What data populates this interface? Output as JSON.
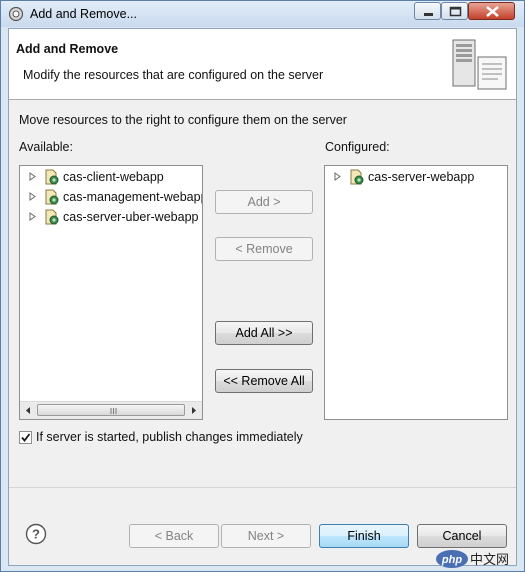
{
  "window": {
    "title": "Add and Remove..."
  },
  "header": {
    "title": "Add and Remove",
    "description": "Modify the resources that are configured on the server"
  },
  "intro_text": "Move resources to the right to configure them on the server",
  "available": {
    "label": "Available:",
    "items": [
      {
        "label": "cas-client-webapp"
      },
      {
        "label": "cas-management-webapp"
      },
      {
        "label": "cas-server-uber-webapp"
      }
    ]
  },
  "configured": {
    "label": "Configured:",
    "items": [
      {
        "label": "cas-server-webapp"
      }
    ]
  },
  "buttons": {
    "add": "Add >",
    "remove": "< Remove",
    "add_all": "Add All >>",
    "remove_all": "<< Remove All",
    "back": "< Back",
    "next": "Next >",
    "finish": "Finish",
    "cancel": "Cancel"
  },
  "publish_option": {
    "label": "If server is started, publish changes immediately",
    "checked": true
  },
  "watermark": "php中文网"
}
